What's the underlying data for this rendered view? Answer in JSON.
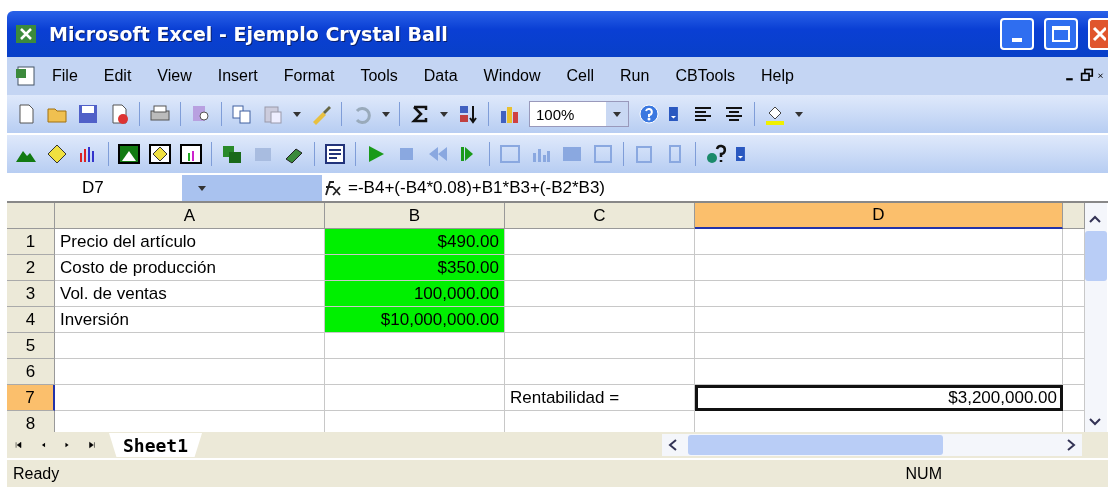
{
  "window": {
    "title": "Microsoft Excel - Ejemplo Crystal Ball"
  },
  "menu": [
    "File",
    "Edit",
    "View",
    "Insert",
    "Format",
    "Tools",
    "Data",
    "Window",
    "Cell",
    "Run",
    "CBTools",
    "Help"
  ],
  "toolbar": {
    "zoom": "100%"
  },
  "formula_bar": {
    "name_box": "D7",
    "formula": "=-B4+(-B4*0.08)+B1*B3+(-B2*B3)"
  },
  "columns": [
    {
      "label": "A",
      "selected": false
    },
    {
      "label": "B",
      "selected": false
    },
    {
      "label": "C",
      "selected": false
    },
    {
      "label": "D",
      "selected": true
    }
  ],
  "rows": [
    {
      "header": "1",
      "selected": false,
      "cells": [
        {
          "text": "Precio del artículo"
        },
        {
          "text": "$490.00",
          "highlighted": true
        },
        {},
        {}
      ]
    },
    {
      "header": "2",
      "selected": false,
      "cells": [
        {
          "text": "Costo de producción"
        },
        {
          "text": "$350.00",
          "highlighted": true
        },
        {},
        {}
      ]
    },
    {
      "header": "3",
      "selected": false,
      "cells": [
        {
          "text": "Vol. de ventas"
        },
        {
          "text": "100,000.00",
          "highlighted": true
        },
        {},
        {}
      ]
    },
    {
      "header": "4",
      "selected": false,
      "cells": [
        {
          "text": "Inversión"
        },
        {
          "text": "$10,000,000.00",
          "highlighted": true
        },
        {},
        {}
      ]
    },
    {
      "header": "5",
      "selected": false,
      "cells": [
        {},
        {},
        {},
        {}
      ]
    },
    {
      "header": "6",
      "selected": false,
      "cells": [
        {},
        {},
        {},
        {}
      ]
    },
    {
      "header": "7",
      "selected": true,
      "cells": [
        {},
        {},
        {
          "text": "Rentabilidad ="
        },
        {
          "text": "$3,200,000.00",
          "active": true
        }
      ]
    },
    {
      "header": "8",
      "selected": false,
      "cells": [
        {},
        {},
        {},
        {}
      ]
    }
  ],
  "sheet_tabs": [
    {
      "label": "Sheet1",
      "selected": true
    }
  ],
  "status_bar": {
    "status": "Ready",
    "indicator": "NUM"
  }
}
